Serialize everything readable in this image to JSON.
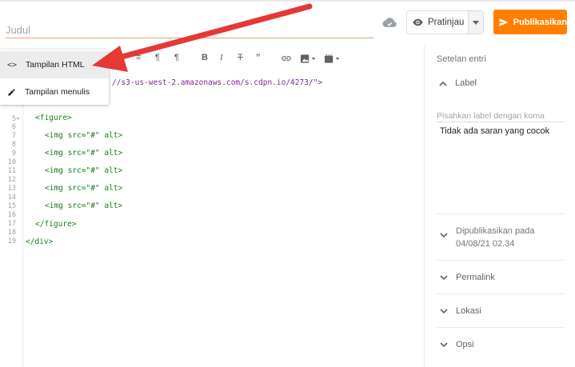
{
  "header": {
    "title_placeholder": "Judul",
    "preview_label": "Pratinjau",
    "publish_label": "Publikasikan"
  },
  "menu": {
    "items": [
      {
        "label": "Tampilan HTML",
        "icon": "code-icon"
      },
      {
        "label": "Tampilan menulis",
        "icon": "pencil-icon"
      }
    ]
  },
  "editor": {
    "line_numbers": [
      "5",
      "6",
      "7",
      "8",
      "9",
      "10",
      "11",
      "12",
      "13",
      "14",
      "15",
      "16",
      "17",
      "18",
      "19"
    ],
    "url_fragment": "//s3-us-west-2.amazonaws.com/s.cdpn.io/4273/\">",
    "figure_open": "<figure>",
    "img_tag": "<img src=\"#\" alt>",
    "figure_close": "</figure>",
    "div_close": "</div>"
  },
  "sidebar": {
    "title": "Setelan entri",
    "label_section": "Label",
    "label_placeholder": "Pisahkan label dengan koma",
    "no_suggestion": "Tidak ada saran yang cocok",
    "published_label": "Dipublikasikan pada",
    "published_date": "04/08/21 02.34",
    "permalink": "Permalink",
    "location": "Lokasi",
    "options": "Opsi"
  },
  "colors": {
    "publish": "#ff8000",
    "arrow": "#e53935"
  }
}
